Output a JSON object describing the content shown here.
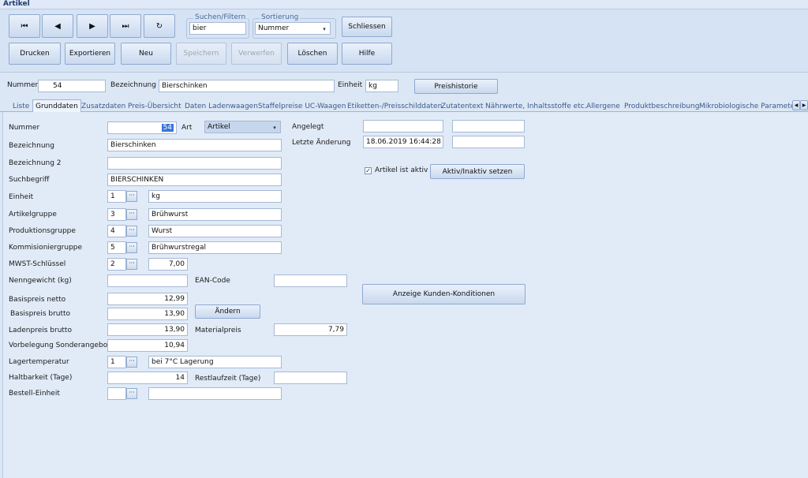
{
  "window": {
    "title": "Artikel"
  },
  "toolbar": {
    "nav": {
      "first": "⏮",
      "prev": "◀",
      "next": "▶",
      "last": "⏭",
      "refresh": "↻"
    },
    "search_group_title": "Suchen/Filtern",
    "search_value": "bier",
    "sort_group_title": "Sortierung",
    "sort_value": "Nummer",
    "close_label": "Schliessen",
    "print_label": "Drucken",
    "export_label": "Exportieren",
    "new_label": "Neu",
    "save_label": "Speichern",
    "discard_label": "Verwerfen",
    "delete_label": "Löschen",
    "help_label": "Hilfe"
  },
  "header": {
    "nummer_label": "Nummer",
    "nummer_value": "54",
    "bezeichnung_label": "Bezeichnung",
    "bezeichnung_value": "Bierschinken",
    "einheit_label": "Einheit",
    "einheit_value": "kg",
    "preishistorie_label": "Preishistorie"
  },
  "tabs": [
    "Liste",
    "Grunddaten",
    "Zusatzdaten",
    "Preis-Übersicht",
    "Daten Ladenwaagen",
    "Staffelpreise UC-Waagen",
    "Etiketten-/Preisschilddaten",
    "Zutatentext",
    "Nährwerte, Inhaltsstoffe etc.",
    "Allergene",
    "Produktbeschreibung",
    "Mikrobiologische Parameter"
  ],
  "tab_scroll": {
    "left": "◀",
    "right": "▶"
  },
  "form": {
    "nummer": {
      "label": "Nummer",
      "value": "54"
    },
    "art": {
      "label": "Art",
      "value": "Artikel"
    },
    "bezeichnung": {
      "label": "Bezeichnung",
      "value": "Bierschinken"
    },
    "bezeichnung2": {
      "label": "Bezeichnung 2",
      "value": ""
    },
    "suchbegriff": {
      "label": "Suchbegriff",
      "value": "BIERSCHINKEN"
    },
    "einheit": {
      "label": "Einheit",
      "code": "1",
      "text": "kg"
    },
    "artikelgruppe": {
      "label": "Artikelgruppe",
      "code": "3",
      "text": "Brühwurst"
    },
    "produktionsgruppe": {
      "label": "Produktionsgruppe",
      "code": "4",
      "text": "Wurst"
    },
    "kommissioniergruppe": {
      "label": "Kommisioniergruppe",
      "code": "5",
      "text": "Brühwurstregal"
    },
    "mwst": {
      "label": "MWST-Schlüssel",
      "code": "2",
      "text": "7,00"
    },
    "nenngewicht": {
      "label": "Nenngewicht (kg)",
      "value": ""
    },
    "ean": {
      "label": "EAN-Code",
      "value": ""
    },
    "basispreis_netto": {
      "label": "Basispreis netto",
      "value": "12,99"
    },
    "basispreis_brutto": {
      "label": "Basispreis brutto",
      "value": "13,90"
    },
    "aendern_label": "Ändern",
    "ladenpreis_brutto": {
      "label": "Ladenpreis brutto",
      "value": "13,90"
    },
    "materialpreis": {
      "label": "Materialpreis",
      "value": "7,79"
    },
    "vorbelegung": {
      "label": "Vorbelegung Sonderangebot",
      "value": "10,94"
    },
    "lagertemperatur": {
      "label": "Lagertemperatur",
      "code": "1",
      "text": "bei 7°C Lagerung"
    },
    "haltbarkeit": {
      "label": "Haltbarkeit (Tage)",
      "value": "14"
    },
    "restlaufzeit": {
      "label": "Restlaufzeit (Tage)",
      "value": ""
    },
    "bestell_einheit": {
      "label": "Bestell-Einheit",
      "code": "",
      "text": ""
    },
    "angelegt": {
      "label": "Angelegt",
      "value1": "",
      "value2": ""
    },
    "letzte_aenderung": {
      "label": "Letzte Änderung",
      "value1": "18.06.2019 16:44:28",
      "value2": ""
    },
    "aktiv": {
      "label": "Artikel ist aktiv",
      "checked": "✓"
    },
    "aktiv_button": "Aktiv/Inaktiv setzen",
    "kunden_button": "Anzeige Kunden-Konditionen",
    "dots": "···",
    "combo_arrow": "▾"
  }
}
